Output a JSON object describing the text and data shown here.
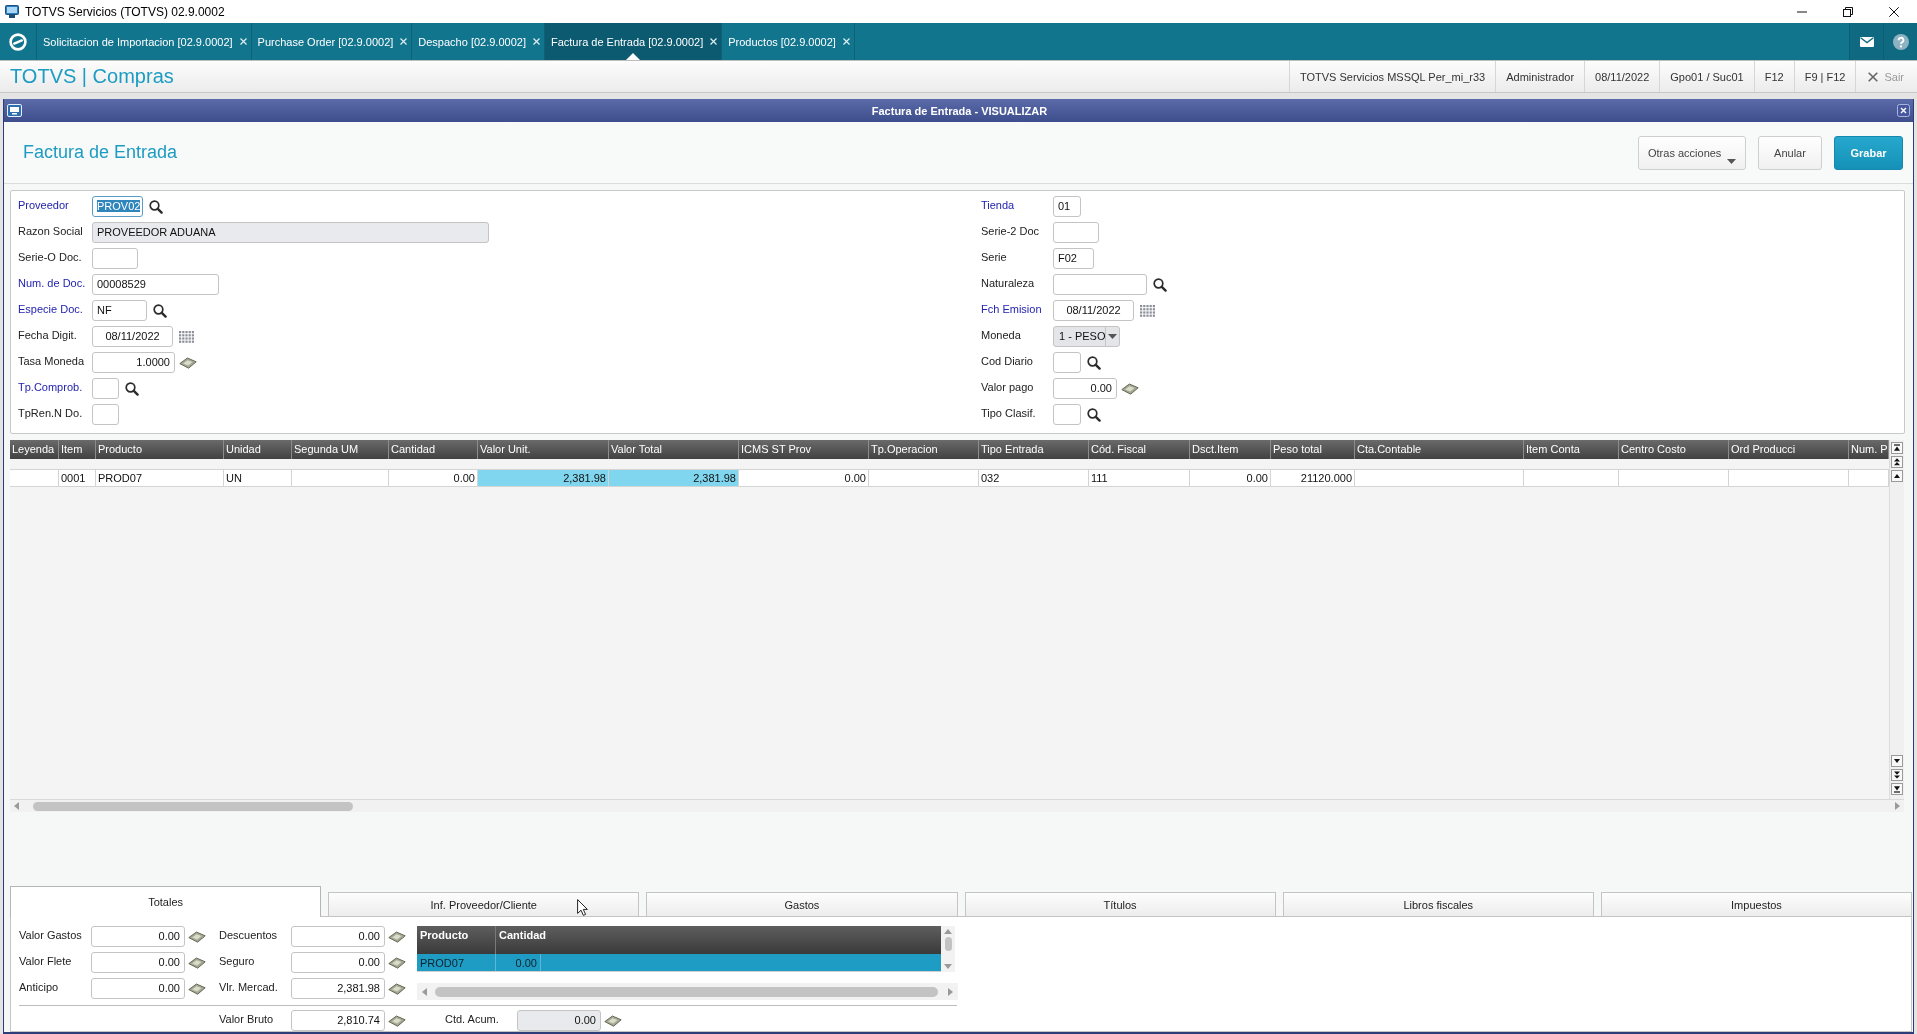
{
  "window": {
    "title": "TOTVS Servicios (TOTVS) 02.9.0002"
  },
  "app_tabs": [
    {
      "label": "Solicitacion de Importacion [02.9.0002]",
      "selected": false
    },
    {
      "label": "Purchase Order [02.9.0002]",
      "selected": false
    },
    {
      "label": "Despacho [02.9.0002]",
      "selected": false
    },
    {
      "label": "Factura de Entrada [02.9.0002]",
      "selected": true
    },
    {
      "label": "Productos [02.9.0002]",
      "selected": false
    }
  ],
  "module_bar": {
    "title": "TOTVS | Compras",
    "items": [
      "TOTVS Servicios MSSQL Per_mi_r33",
      "Administrador",
      "08/11/2022",
      "Gpo01 / Suc01",
      "F12",
      "F9 | F12"
    ],
    "exit": {
      "label": "Sair",
      "disabled": true
    }
  },
  "dialog": {
    "title": "Factura de Entrada - VISUALIZAR",
    "heading": "Factura de Entrada",
    "buttons": [
      {
        "label": "Otras acciones",
        "kind": "menu"
      },
      {
        "label": "Anular",
        "kind": "default"
      },
      {
        "label": "Grabar",
        "kind": "primary"
      }
    ],
    "form": {
      "left": [
        {
          "label": "Proveedor",
          "kind": "lookup",
          "value": "PROV02",
          "required": true,
          "disabled": false,
          "selected": true
        },
        {
          "label": "Razon Social",
          "kind": "text",
          "value": "PROVEEDOR ADUANA",
          "required": false,
          "disabled": true,
          "selected": false
        },
        {
          "label": "Serie-O Doc.",
          "kind": "text",
          "required": false,
          "disabled": false,
          "selected": false
        },
        {
          "label": "Num. de Doc.",
          "kind": "text",
          "value": "00008529",
          "required": true,
          "disabled": false,
          "selected": false
        },
        {
          "label": "Especie Doc.",
          "kind": "lookup",
          "value": "NF",
          "required": true,
          "disabled": false,
          "selected": false
        },
        {
          "label": "Fecha Digit.",
          "kind": "date",
          "value": "08/11/2022",
          "required": false,
          "disabled": false,
          "selected": false
        },
        {
          "label": "Tasa Moneda",
          "kind": "number",
          "value": "1.0000",
          "required": false,
          "disabled": false,
          "selected": false
        },
        {
          "label": "Tp.Comprob.",
          "kind": "lookup",
          "required": true,
          "disabled": false,
          "selected": false
        },
        {
          "label": "TpRen.N Do.",
          "kind": "text",
          "required": false,
          "disabled": false,
          "selected": false
        }
      ],
      "right": [
        {
          "label": "Tienda",
          "kind": "text",
          "value": "01",
          "required": true,
          "disabled": false,
          "selected": false
        },
        {
          "label": "Serie-2 Doc",
          "kind": "text",
          "required": false,
          "disabled": false,
          "selected": false
        },
        {
          "label": "Serie",
          "kind": "text",
          "value": "F02",
          "required": false,
          "disabled": false,
          "selected": false
        },
        {
          "label": "Naturaleza",
          "kind": "lookup",
          "required": false,
          "disabled": false,
          "selected": false
        },
        {
          "label": "Fch Emision",
          "kind": "date",
          "value": "08/11/2022",
          "required": true,
          "disabled": false,
          "selected": false
        },
        {
          "label": "Moneda",
          "kind": "select",
          "value": "1 - PESO",
          "required": false,
          "disabled": true,
          "selected": false
        },
        {
          "label": "Cod Diario",
          "kind": "lookup",
          "required": false,
          "disabled": false,
          "selected": false
        },
        {
          "label": "Valor pago",
          "kind": "number",
          "value": "0.00",
          "required": false,
          "disabled": false,
          "selected": false
        },
        {
          "label": "Tipo Clasif.",
          "kind": "lookup",
          "required": false,
          "disabled": false,
          "selected": false
        }
      ]
    },
    "grid": {
      "columns": [
        "Leyenda",
        "Item",
        "Producto",
        "Unidad",
        "Segunda UM",
        "Cantidad",
        "Valor Unit.",
        "Valor Total",
        "ICMS ST Prov",
        "Tp.Operacion",
        "Tipo Entrada",
        "Cód. Fiscal",
        "Dsct.Item",
        "Peso total",
        "Cta.Contable",
        "Item Conta",
        "Centro Costo",
        "Ord Producci",
        "Num. P"
      ],
      "rows": [
        {
          "cells": [
            {
              "highlighted": false
            },
            {
              "text": "0001",
              "highlighted": false
            },
            {
              "text": "PROD07",
              "highlighted": false
            },
            {
              "text": "UN",
              "highlighted": false
            },
            {
              "highlighted": false
            },
            {
              "text": "0.00",
              "highlighted": false
            },
            {
              "text": "2,381.98",
              "highlighted": true
            },
            {
              "text": "2,381.98",
              "highlighted": true
            },
            {
              "text": "0.00",
              "highlighted": false
            },
            {
              "highlighted": false
            },
            {
              "text": "032",
              "highlighted": false
            },
            {
              "text": "111",
              "highlighted": false
            },
            {
              "text": "0.00",
              "highlighted": false
            },
            {
              "text": "21120.000",
              "highlighted": false
            },
            {
              "highlighted": false
            },
            {
              "highlighted": false
            },
            {
              "highlighted": false
            },
            {
              "highlighted": false
            },
            {
              "highlighted": false
            }
          ]
        }
      ]
    },
    "folders": {
      "tabs": [
        {
          "label": "Totales",
          "selected": true
        },
        {
          "label": "Inf. Proveedor/Cliente",
          "selected": false
        },
        {
          "label": "Gastos",
          "selected": false
        },
        {
          "label": "Títulos",
          "selected": false
        },
        {
          "label": "Libros fiscales",
          "selected": false
        },
        {
          "label": "Impuestos",
          "selected": false
        }
      ],
      "totals": {
        "left_fields": [
          {
            "label": "Valor Gastos",
            "value": "0.00",
            "disabled": false
          },
          {
            "label": "Valor Flete",
            "value": "0.00",
            "disabled": false
          },
          {
            "label": "Anticipo",
            "value": "0.00",
            "disabled": false
          }
        ],
        "middle_fields": [
          {
            "label": "Descuentos",
            "value": "0.00",
            "disabled": false
          },
          {
            "label": "Seguro",
            "value": "0.00",
            "disabled": false
          },
          {
            "label": "Vlr. Mercad.",
            "value": "2,381.98",
            "disabled": false
          }
        ],
        "items_grid": {
          "columns": [
            "Producto",
            "Cantidad"
          ],
          "rows": [
            {
              "cells": [
                "PROD07",
                "0.00"
              ],
              "selected": true
            }
          ]
        },
        "summary_fields": [
          {
            "label": "Valor Bruto",
            "value": "2,810.74",
            "disabled": false
          },
          {
            "label": "Ctd. Acum.",
            "value": "0.00",
            "disabled": true
          }
        ]
      }
    }
  }
}
